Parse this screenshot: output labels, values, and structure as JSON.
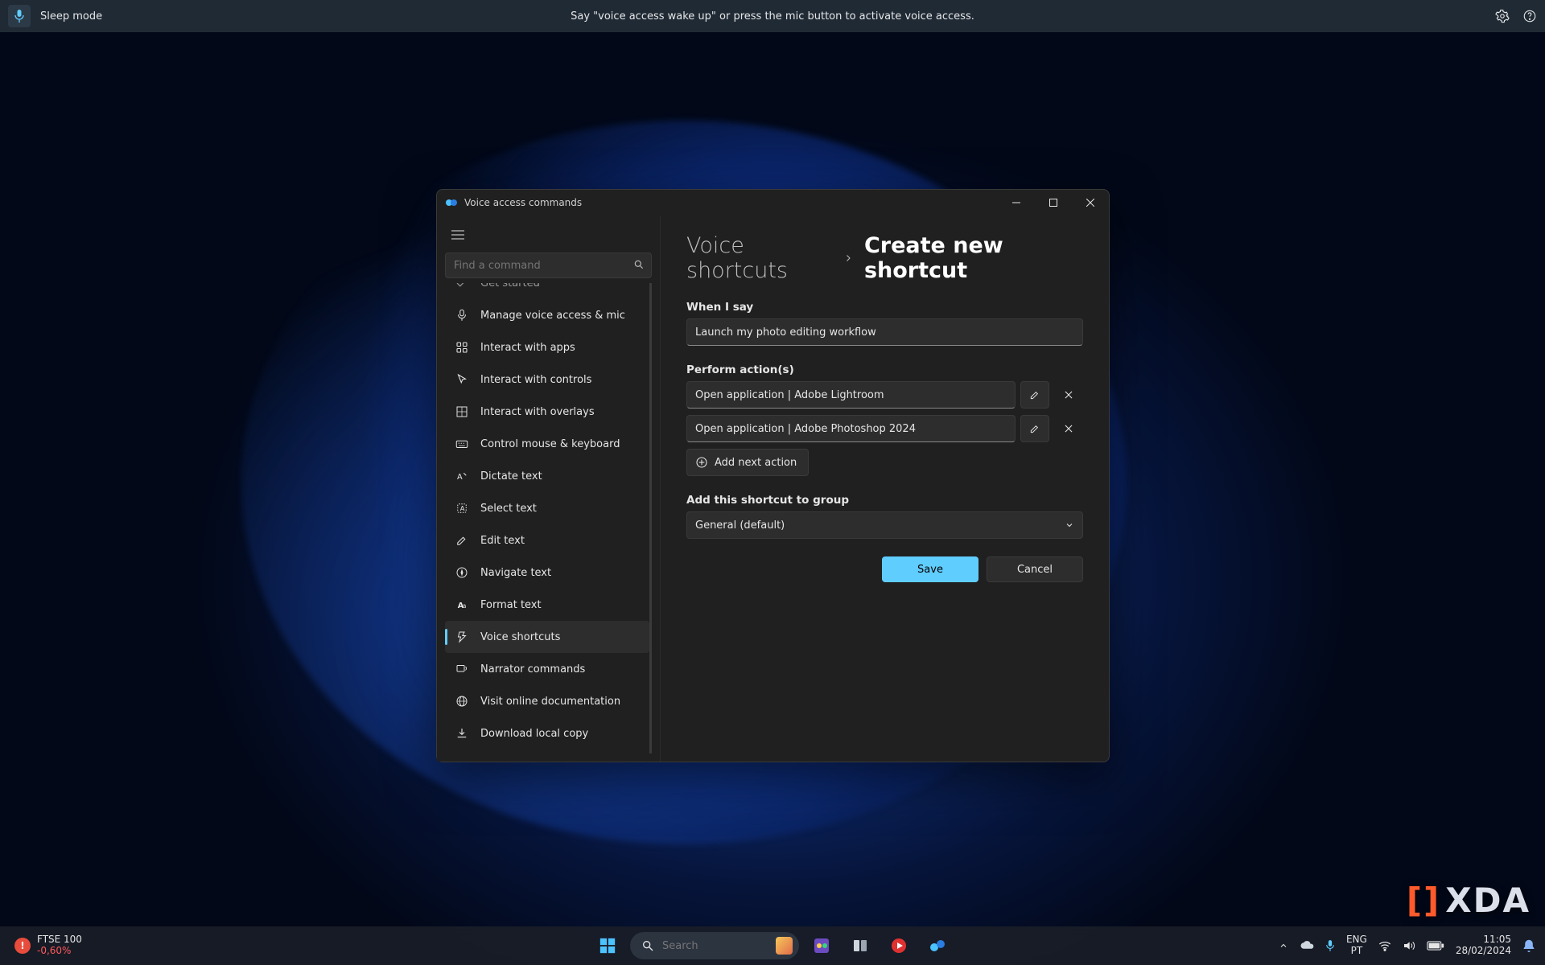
{
  "voice_bar": {
    "mode": "Sleep mode",
    "hint": "Say \"voice access wake up\" or press the mic button to activate voice access."
  },
  "window": {
    "title": "Voice access commands",
    "search_placeholder": "Find a command"
  },
  "sidebar": {
    "items": [
      {
        "label": "Get started",
        "icon": "check"
      },
      {
        "label": "Manage voice access & mic",
        "icon": "mic"
      },
      {
        "label": "Interact with apps",
        "icon": "apps"
      },
      {
        "label": "Interact with controls",
        "icon": "cursor"
      },
      {
        "label": "Interact with overlays",
        "icon": "grid"
      },
      {
        "label": "Control mouse & keyboard",
        "icon": "keyboard"
      },
      {
        "label": "Dictate text",
        "icon": "dictate"
      },
      {
        "label": "Select text",
        "icon": "select"
      },
      {
        "label": "Edit text",
        "icon": "edit"
      },
      {
        "label": "Navigate text",
        "icon": "navigate"
      },
      {
        "label": "Format text",
        "icon": "format"
      },
      {
        "label": "Voice shortcuts",
        "icon": "shortcut"
      },
      {
        "label": "Narrator commands",
        "icon": "narrator"
      },
      {
        "label": "Visit online documentation",
        "icon": "globe"
      },
      {
        "label": "Download local copy",
        "icon": "download"
      }
    ],
    "selected_index": 11
  },
  "breadcrumb": {
    "root": "Voice shortcuts",
    "leaf": "Create new shortcut"
  },
  "form": {
    "when_label": "When I say",
    "when_value": "Launch my photo editing workflow",
    "actions_label": "Perform action(s)",
    "actions": [
      "Open application | Adobe Lightroom",
      "Open application | Adobe Photoshop 2024"
    ],
    "add_next": "Add next action",
    "group_label": "Add this shortcut to group",
    "group_value": "General (default)",
    "save": "Save",
    "cancel": "Cancel"
  },
  "taskbar": {
    "stock": {
      "name": "FTSE 100",
      "change": "-0,60%"
    },
    "search_placeholder": "Search",
    "lang_top": "ENG",
    "lang_bottom": "PT",
    "time": "11:05",
    "date": "28/02/2024"
  },
  "watermark": "XDA"
}
